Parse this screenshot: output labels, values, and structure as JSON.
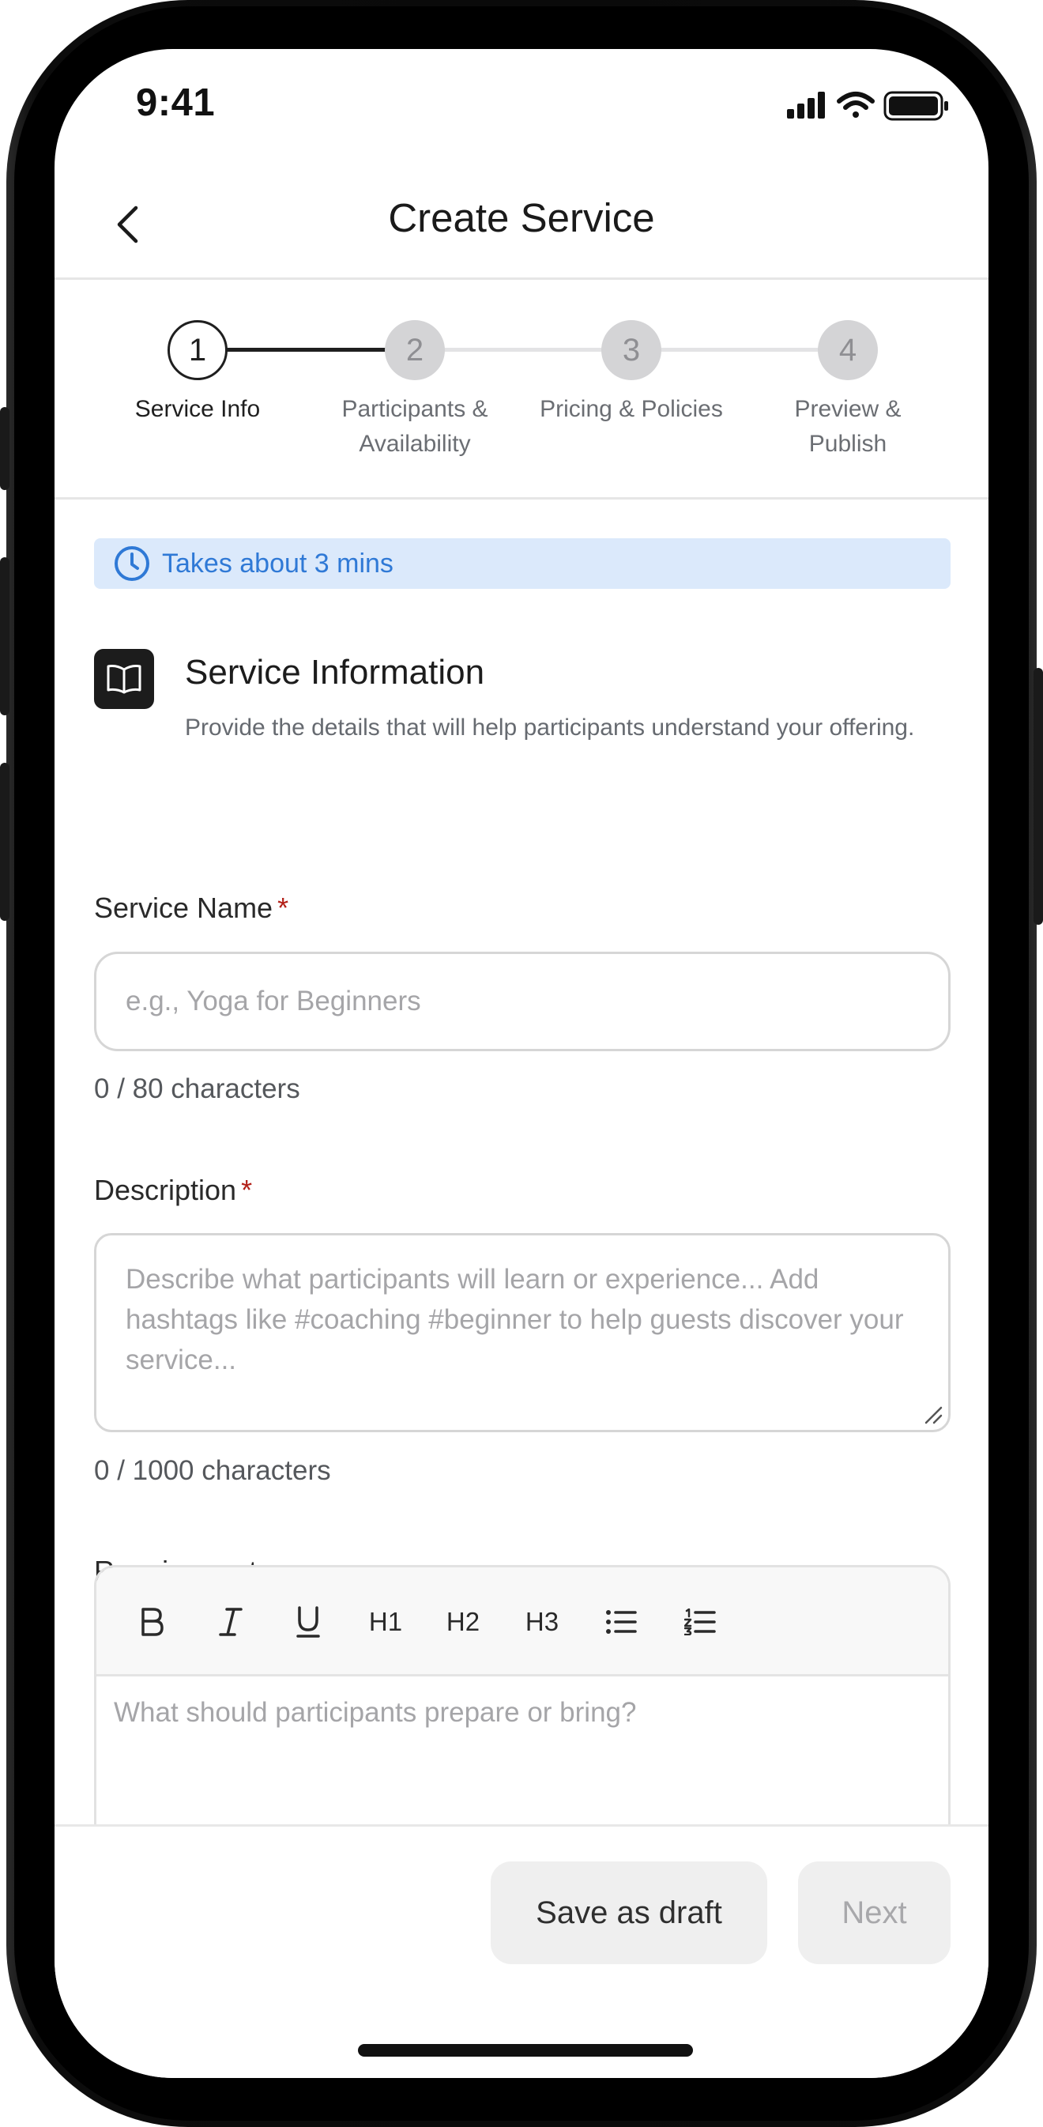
{
  "status_bar": {
    "time": "9:41"
  },
  "header": {
    "title": "Create Service"
  },
  "stepper": {
    "steps": [
      {
        "number": "1",
        "label_line1": "Service Info",
        "label_line2": ""
      },
      {
        "number": "2",
        "label_line1": "Participants &",
        "label_line2": "Availability"
      },
      {
        "number": "3",
        "label_line1": "Pricing & Policies",
        "label_line2": ""
      },
      {
        "number": "4",
        "label_line1": "Preview &",
        "label_line2": "Publish"
      }
    ],
    "current_step": 1
  },
  "banner": {
    "text": "Takes about 3 mins"
  },
  "section": {
    "title": "Service Information",
    "description": "Provide the details that will help participants understand your offering."
  },
  "form": {
    "service_name": {
      "label": "Service Name",
      "required_mark": "*",
      "value": "",
      "placeholder": "e.g., Yoga for Beginners",
      "counter": "0 / 80 characters"
    },
    "description": {
      "label": "Description",
      "required_mark": "*",
      "value": "",
      "placeholder": "Describe what participants will learn or experience... Add hashtags like #coaching #beginner to help guests discover your service...",
      "counter": "0 / 1000 characters"
    },
    "requirements": {
      "label": "Requirements",
      "placeholder": "What should participants prepare or bring?",
      "toolbar": {
        "bold": "B",
        "italic": "I",
        "underline": "U",
        "h1": "H1",
        "h2": "H2",
        "h3": "H3"
      }
    }
  },
  "footer": {
    "save_draft": "Save as draft",
    "next": "Next"
  },
  "colors": {
    "accent_blue": "#2f79d6",
    "banner_bg": "#dbe9fb",
    "required_red": "#b32018"
  }
}
